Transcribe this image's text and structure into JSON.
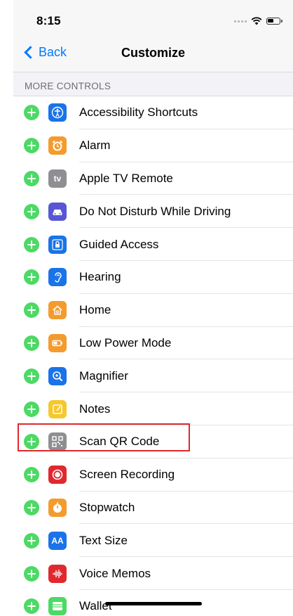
{
  "status_bar": {
    "time": "8:15"
  },
  "nav": {
    "back_label": "Back",
    "title": "Customize"
  },
  "section": {
    "header": "MORE CONTROLS"
  },
  "controls": [
    {
      "label": "Accessibility Shortcuts",
      "icon": "accessibility-icon",
      "color": "#1a73e8"
    },
    {
      "label": "Alarm",
      "icon": "alarm-clock-icon",
      "color": "#f49b2d"
    },
    {
      "label": "Apple TV Remote",
      "icon": "apple-tv-icon",
      "color": "#8e8e93",
      "icon_text": "tv"
    },
    {
      "label": "Do Not Disturb While Driving",
      "icon": "car-icon",
      "color": "#5856d6"
    },
    {
      "label": "Guided Access",
      "icon": "lock-icon",
      "color": "#1a73e8"
    },
    {
      "label": "Hearing",
      "icon": "ear-icon",
      "color": "#1a73e8"
    },
    {
      "label": "Home",
      "icon": "home-icon",
      "color": "#f49b2d"
    },
    {
      "label": "Low Power Mode",
      "icon": "battery-icon",
      "color": "#f49b2d"
    },
    {
      "label": "Magnifier",
      "icon": "magnifier-icon",
      "color": "#1a73e8"
    },
    {
      "label": "Notes",
      "icon": "notes-icon",
      "color": "#f7c72e"
    },
    {
      "label": "Scan QR Code",
      "icon": "qr-code-icon",
      "color": "#8e8e93"
    },
    {
      "label": "Screen Recording",
      "icon": "record-icon",
      "color": "#e0282e"
    },
    {
      "label": "Stopwatch",
      "icon": "stopwatch-icon",
      "color": "#f49b2d"
    },
    {
      "label": "Text Size",
      "icon": "text-size-icon",
      "color": "#1a73e8",
      "icon_text": "AA"
    },
    {
      "label": "Voice Memos",
      "icon": "waveform-icon",
      "color": "#e0282e"
    },
    {
      "label": "Wallet",
      "icon": "wallet-icon",
      "color": "#4cd964"
    }
  ],
  "highlight": {
    "color": "#e0282e",
    "target": "Screen Recording"
  }
}
